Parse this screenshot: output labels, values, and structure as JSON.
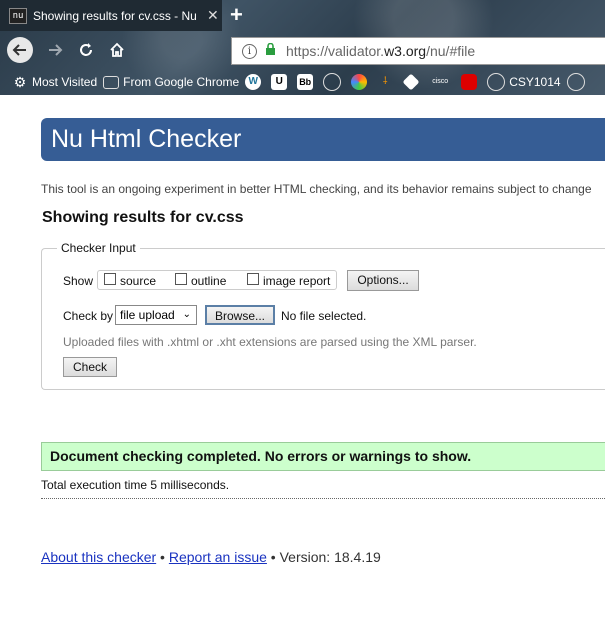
{
  "browser": {
    "tab_favicon_text": "nu",
    "tab_title": "Showing results for cv.css - Nu Html Checker",
    "tab_close": "✕",
    "new_tab": "+",
    "url_prefix": "https://validator.",
    "url_host": "w3.org",
    "url_path": "/nu/#file",
    "bookmarks": [
      {
        "label": "Most Visited",
        "icon": "gear-icon"
      },
      {
        "label": "From Google Chrome",
        "icon": "folder-icon"
      },
      {
        "label": "",
        "icon": "wordpress-icon"
      },
      {
        "label": "",
        "icon": "uon-icon",
        "text": "U"
      },
      {
        "label": "",
        "icon": "blackboard-icon",
        "text": "Bb"
      },
      {
        "label": "",
        "icon": "globe-icon"
      },
      {
        "label": "",
        "icon": "colorful-icon"
      },
      {
        "label": "",
        "icon": "tool-icon"
      },
      {
        "label": "",
        "icon": "diamond-icon"
      },
      {
        "label": "",
        "icon": "cisco-icon",
        "text": "cisco"
      },
      {
        "label": "",
        "icon": "oracle-icon"
      },
      {
        "label": "CSY1014",
        "icon": "globe-icon"
      },
      {
        "label": "",
        "icon": "globe-icon"
      }
    ]
  },
  "page": {
    "banner_title": "Nu Html Checker",
    "intro": "This tool is an ongoing experiment in better HTML checking, and its behavior remains subject to change",
    "heading": "Showing results for cv.css",
    "checker_input": {
      "legend": "Checker Input",
      "show_label": "Show",
      "options": [
        {
          "label": "source",
          "checked": false
        },
        {
          "label": "outline",
          "checked": false
        },
        {
          "label": "image report",
          "checked": false
        }
      ],
      "options_button": "Options...",
      "check_by_label": "Check by",
      "check_by_value": "file upload",
      "browse_button": "Browse...",
      "file_status": "No file selected.",
      "hint": "Uploaded files with .xhtml or .xht extensions are parsed using the XML parser.",
      "check_button": "Check"
    },
    "result_message": "Document checking completed. No errors or warnings to show.",
    "execution_time": "Total execution time 5 milliseconds.",
    "footer": {
      "about_link": "About this checker",
      "sep1": " • ",
      "report_link": "Report an issue",
      "sep2": " • ",
      "version": "Version: 18.4.19"
    }
  }
}
